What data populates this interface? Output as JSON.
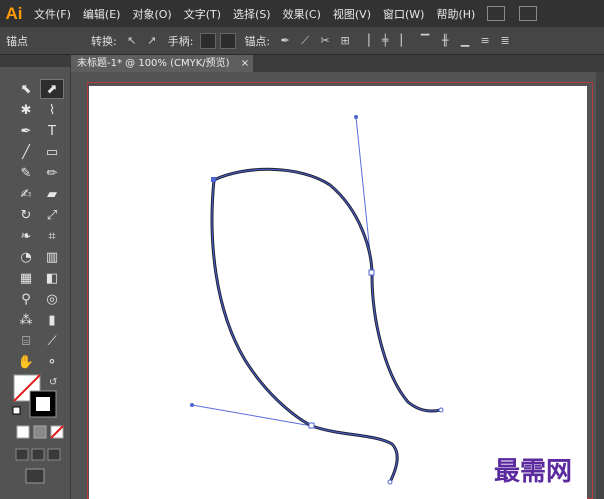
{
  "app": {
    "logo": "Ai"
  },
  "menu": [
    "文件(F)",
    "编辑(E)",
    "对象(O)",
    "文字(T)",
    "选择(S)",
    "效果(C)",
    "视图(V)",
    "窗口(W)",
    "帮助(H)"
  ],
  "control_bar": {
    "mode": "锚点",
    "convert_label": "转换:",
    "handles_label": "手柄:",
    "anchor_label": "锚点:"
  },
  "tab": {
    "title": "未标题-1* @ 100% (CMYK/预览)",
    "close": "×"
  },
  "watermark": "最需网",
  "tools": [
    {
      "name": "selection-tool",
      "glyph": "⬉"
    },
    {
      "name": "direct-selection-tool",
      "glyph": "⬈",
      "active": true
    },
    {
      "name": "magic-wand-tool",
      "glyph": "✱"
    },
    {
      "name": "lasso-tool",
      "glyph": "⌇"
    },
    {
      "name": "pen-tool",
      "glyph": "✒"
    },
    {
      "name": "type-tool",
      "glyph": "T"
    },
    {
      "name": "line-tool",
      "glyph": "╱"
    },
    {
      "name": "rectangle-tool",
      "glyph": "▭"
    },
    {
      "name": "paintbrush-tool",
      "glyph": "✎"
    },
    {
      "name": "pencil-tool",
      "glyph": "✏"
    },
    {
      "name": "blob-brush-tool",
      "glyph": "✍"
    },
    {
      "name": "eraser-tool",
      "glyph": "▰"
    },
    {
      "name": "rotate-tool",
      "glyph": "↻"
    },
    {
      "name": "scale-tool",
      "glyph": "⤢"
    },
    {
      "name": "warp-tool",
      "glyph": "❧"
    },
    {
      "name": "free-transform-tool",
      "glyph": "⌗"
    },
    {
      "name": "shape-builder-tool",
      "glyph": "◔"
    },
    {
      "name": "perspective-grid-tool",
      "glyph": "▥"
    },
    {
      "name": "mesh-tool",
      "glyph": "▦"
    },
    {
      "name": "gradient-tool",
      "glyph": "◧"
    },
    {
      "name": "eyedropper-tool",
      "glyph": "⚲"
    },
    {
      "name": "blend-tool",
      "glyph": "◎"
    },
    {
      "name": "symbol-sprayer-tool",
      "glyph": "⁂"
    },
    {
      "name": "column-graph-tool",
      "glyph": "▮"
    },
    {
      "name": "artboard-tool",
      "glyph": "⌸"
    },
    {
      "name": "slice-tool",
      "glyph": "⟋"
    },
    {
      "name": "hand-tool",
      "glyph": "✋"
    },
    {
      "name": "zoom-tool",
      "glyph": "⚬"
    }
  ]
}
